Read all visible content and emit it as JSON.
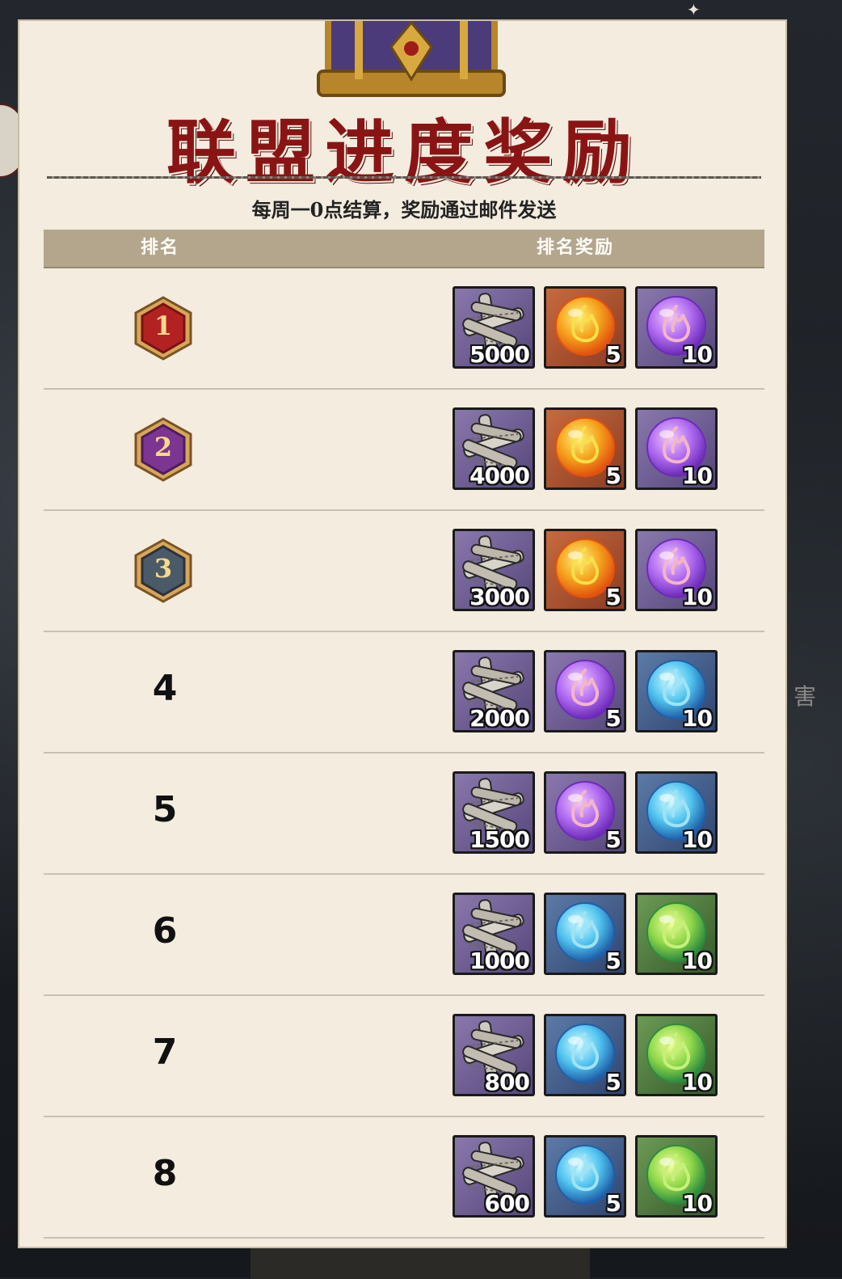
{
  "header": {
    "title": "联盟进度奖励",
    "subtitle": "每周一0点结算，奖励通过邮件发送"
  },
  "table": {
    "col_rank": "排名",
    "col_reward": "排名奖励"
  },
  "colors": {
    "title_red": "#8a1414",
    "panel_bg": "#f3ecdf",
    "header_bg": "#b4a68d",
    "medal_gold": "#a01c1c",
    "medal_silver": "#6b2a7a",
    "medal_bronze": "#3d4a56"
  },
  "rows": [
    {
      "rank": "1",
      "medal": "medal-1-icon",
      "rewards": [
        {
          "icon": "scroll-bundle-icon",
          "qty": "5000"
        },
        {
          "icon": "fire-orb-orange-icon",
          "qty": "5"
        },
        {
          "icon": "fire-orb-purple-icon",
          "qty": "10"
        }
      ]
    },
    {
      "rank": "2",
      "medal": "medal-2-icon",
      "rewards": [
        {
          "icon": "scroll-bundle-icon",
          "qty": "4000"
        },
        {
          "icon": "fire-orb-orange-icon",
          "qty": "5"
        },
        {
          "icon": "fire-orb-purple-icon",
          "qty": "10"
        }
      ]
    },
    {
      "rank": "3",
      "medal": "medal-3-icon",
      "rewards": [
        {
          "icon": "scroll-bundle-icon",
          "qty": "3000"
        },
        {
          "icon": "fire-orb-orange-icon",
          "qty": "5"
        },
        {
          "icon": "fire-orb-purple-icon",
          "qty": "10"
        }
      ]
    },
    {
      "rank": "4",
      "rewards": [
        {
          "icon": "scroll-bundle-icon",
          "qty": "2000"
        },
        {
          "icon": "fire-orb-purple-icon",
          "qty": "5"
        },
        {
          "icon": "fire-orb-blue-icon",
          "qty": "10"
        }
      ]
    },
    {
      "rank": "5",
      "rewards": [
        {
          "icon": "scroll-bundle-icon",
          "qty": "1500"
        },
        {
          "icon": "fire-orb-purple-icon",
          "qty": "5"
        },
        {
          "icon": "fire-orb-blue-icon",
          "qty": "10"
        }
      ]
    },
    {
      "rank": "6",
      "rewards": [
        {
          "icon": "scroll-bundle-icon",
          "qty": "1000"
        },
        {
          "icon": "fire-orb-blue-icon",
          "qty": "5"
        },
        {
          "icon": "fire-orb-green-icon",
          "qty": "10"
        }
      ]
    },
    {
      "rank": "7",
      "rewards": [
        {
          "icon": "scroll-bundle-icon",
          "qty": "800"
        },
        {
          "icon": "fire-orb-blue-icon",
          "qty": "5"
        },
        {
          "icon": "fire-orb-green-icon",
          "qty": "10"
        }
      ]
    },
    {
      "rank": "8",
      "rewards": [
        {
          "icon": "scroll-bundle-icon",
          "qty": "600"
        },
        {
          "icon": "fire-orb-blue-icon",
          "qty": "5"
        },
        {
          "icon": "fire-orb-green-icon",
          "qty": "10"
        }
      ]
    }
  ],
  "background": {
    "side_char": "害"
  }
}
